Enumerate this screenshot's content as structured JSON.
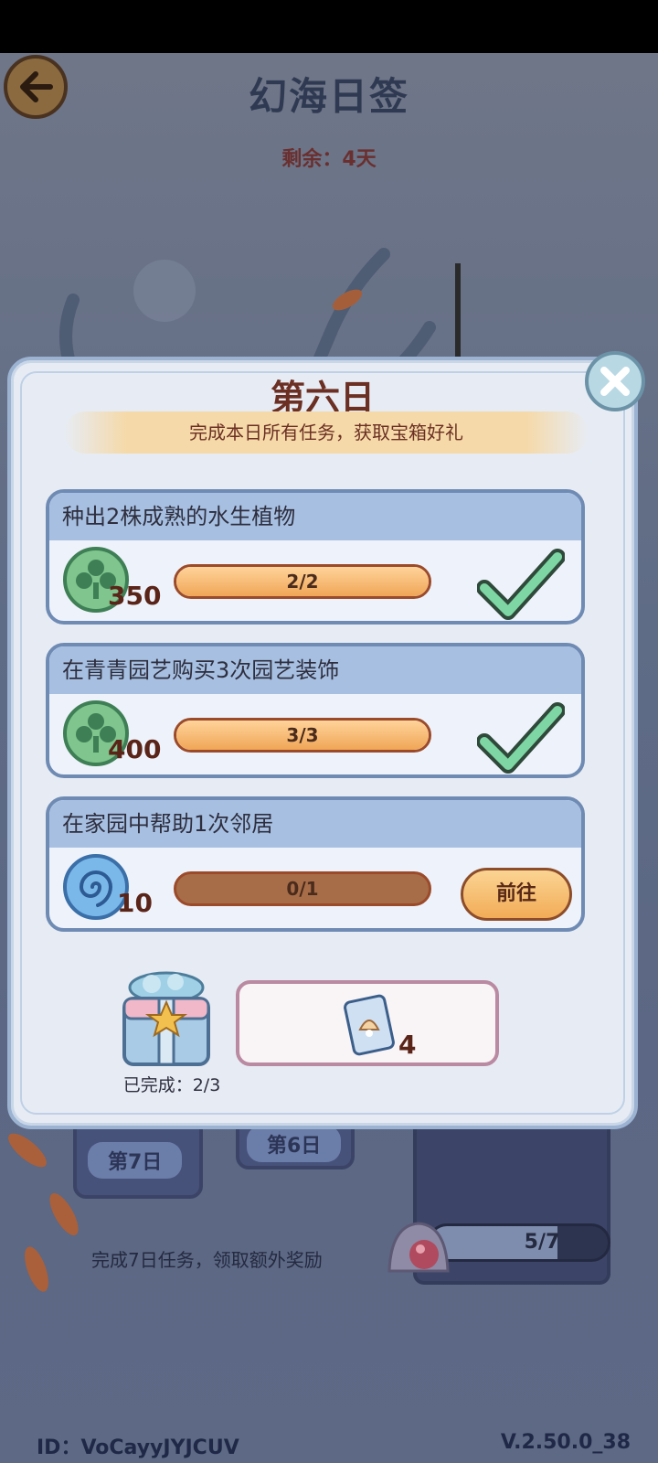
{
  "header": {
    "title": "幻海日签",
    "remaining": "剩余：4天"
  },
  "modal": {
    "day_title": "第六日",
    "subtitle": "完成本日所有任务，获取宝箱好礼",
    "tasks": [
      {
        "title": "种出2株成熟的水生植物",
        "reward_icon": "clover-coin-icon",
        "reward_count": "350",
        "progress_text": "2/2",
        "progress": 1.0,
        "status": "completed"
      },
      {
        "title": "在青青园艺购买3次园艺装饰",
        "reward_icon": "clover-coin-icon",
        "reward_count": "400",
        "progress_text": "3/3",
        "progress": 1.0,
        "status": "completed"
      },
      {
        "title": "在家园中帮助1次邻居",
        "reward_icon": "swirl-shell-icon",
        "reward_count": "10",
        "progress_text": "0/1",
        "progress": 0.0,
        "status": "pending",
        "button_label": "前往"
      }
    ],
    "chest_label": "已完成：2/3",
    "chest_reward_count": "4"
  },
  "background": {
    "day7_label": "第7日",
    "day6_label": "第6日",
    "bonus_note": "完成7日任务，领取额外奖励",
    "bonus_progress_text": "5/7",
    "bonus_progress": 0.714
  },
  "footer": {
    "id": "ID：VoCayyJYJCUV",
    "version": "V.2.50.0_38"
  },
  "colors": {
    "accent": "#f2ac57",
    "title": "#6b2f23",
    "check": "#6fcf97"
  }
}
